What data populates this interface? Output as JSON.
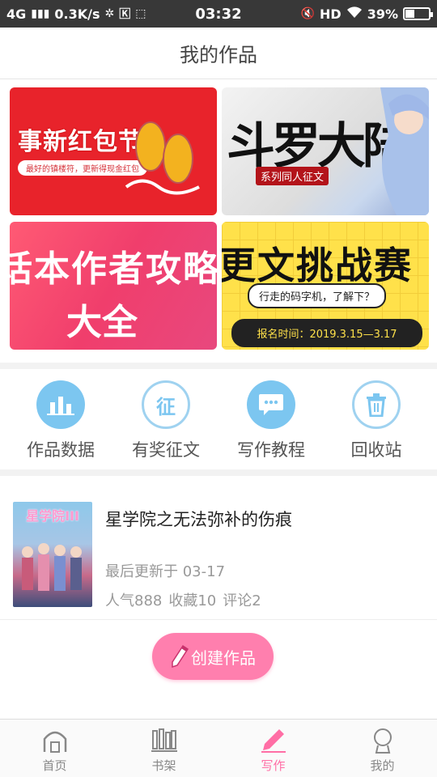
{
  "status_bar": {
    "network": "4G",
    "speed": "0.3K/s",
    "time": "03:32",
    "hd": "HD",
    "battery": "39%",
    "battery_level": 0.39
  },
  "header": {
    "title": "我的作品"
  },
  "banners": [
    {
      "title": "事新红包节",
      "subtitle": "最好的镇楼符，更新得现金红包"
    },
    {
      "title": "斗罗大陆",
      "tag": "系列同人征文"
    },
    {
      "title": "话本作者攻略",
      "line2": "大全"
    },
    {
      "title": "更文挑战赛",
      "subtitle": "行走的码字机，了解下？",
      "date_text": "报名时间：2019.3.15—3.17"
    }
  ],
  "actions": [
    {
      "label": "作品数据",
      "icon": "bar-chart-icon"
    },
    {
      "label": "有奖征文",
      "icon": "zheng-icon",
      "glyph": "征"
    },
    {
      "label": "写作教程",
      "icon": "chat-bubble-icon"
    },
    {
      "label": "回收站",
      "icon": "trash-icon"
    }
  ],
  "works": [
    {
      "title": "星学院之无法弥补的伤痕",
      "cover_title": "星学院III",
      "updated": "最后更新于 03-17",
      "popularity": "人气888",
      "favorites": "收藏10",
      "comments": "评论2"
    }
  ],
  "create_button": {
    "label": "创建作品"
  },
  "tabs": [
    {
      "label": "首页",
      "icon": "home-icon"
    },
    {
      "label": "书架",
      "icon": "bookshelf-icon"
    },
    {
      "label": "写作",
      "icon": "pen-icon",
      "active": true
    },
    {
      "label": "我的",
      "icon": "user-icon"
    }
  ],
  "colors": {
    "accent": "#ff6ea5",
    "action_blue": "#7cc6f0",
    "status_bar": "#383838"
  }
}
